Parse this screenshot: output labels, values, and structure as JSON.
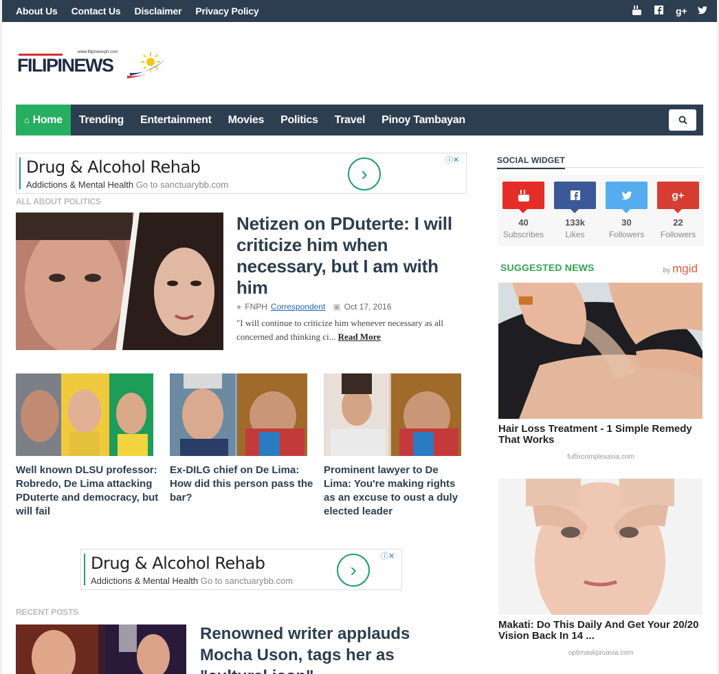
{
  "topbar": {
    "links": [
      "About Us",
      "Contact Us",
      "Disclaimer",
      "Privacy Policy"
    ],
    "social_icons": [
      "youtube-icon",
      "facebook-icon",
      "google-plus-icon",
      "twitter-icon"
    ]
  },
  "logo": {
    "url": "www.filipinewsph.com",
    "word": "FILIPINEWS"
  },
  "nav": {
    "items": [
      "Home",
      "Trending",
      "Entertainment",
      "Movies",
      "Politics",
      "Travel",
      "Pinoy Tambayan"
    ]
  },
  "ads": [
    {
      "title": "Drug & Alcohol Rehab",
      "sub": "Addictions & Mental Health",
      "go": "Go to sanctuarybb.com"
    },
    {
      "title": "Drug & Alcohol Rehab",
      "sub": "Addictions & Mental Health",
      "go": "Go to sanctuarybb.com"
    }
  ],
  "sections": {
    "politics": "ALL ABOUT POLITICS",
    "recent": "RECENT POSTS"
  },
  "feature": {
    "title": "Netizen on PDuterte: I will criticize him when necessary, but I am with him",
    "author": "FNPH",
    "author_link": "Correspondent",
    "date": "Oct 17, 2016",
    "excerpt": "\"I will continue to criticize him whenever necessary as all concerned and thinking ci...",
    "read_more": "Read More"
  },
  "cards": [
    {
      "title": "Well known DLSU professor: Robredo, De Lima attacking PDuterte and democracy, but will fail"
    },
    {
      "title": "Ex-DILG chief on De Lima: How did this person pass the bar?"
    },
    {
      "title": "Prominent lawyer to De Lima: You're making rights as an excuse to oust a duly elected leader"
    }
  ],
  "recent": {
    "title": "Renowned writer applauds Mocha Uson, tags her as \"cultural icon\""
  },
  "social_widget": {
    "heading": "SOCIAL WIDGET",
    "items": [
      {
        "icon": "youtube-icon",
        "count": "40",
        "label": "Subscribes",
        "color": "#e52d27"
      },
      {
        "icon": "facebook-icon",
        "count": "133k",
        "label": "Likes",
        "color": "#3b5998"
      },
      {
        "icon": "twitter-icon",
        "count": "30",
        "label": "Followers",
        "color": "#55acee"
      },
      {
        "icon": "google-plus-icon",
        "count": "22",
        "label": "Followers",
        "color": "#d73d32"
      }
    ]
  },
  "suggested": {
    "heading": "SUGGESTED NEWS",
    "by": "by",
    "brand": "mgid",
    "items": [
      {
        "title": "Hair Loss Treatment - 1 Simple Remedy That Works",
        "source": "fulfixcomplexasia.com"
      },
      {
        "title": "Makati: Do This Daily And Get Your 20/20 Vision Back In 14 ...",
        "source": "optimaskproasia.com"
      }
    ]
  },
  "colors": {
    "navy": "#2c3e50",
    "green": "#27ae60",
    "link": "#1f66b5"
  }
}
